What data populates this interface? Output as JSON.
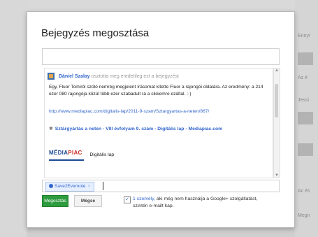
{
  "background": {
    "top_text": "",
    "right_labels": [
      "Ennyi",
      "Az é",
      "Jessi",
      "Ac és",
      "Megn"
    ]
  },
  "dialog": {
    "title": "Bejegyzés megosztása",
    "comment_placeholder": "",
    "post": {
      "author": "Dániel Szalay",
      "action": "osztotta meg eredetileg ezt a bejegyzést",
      "text": "Egy, Fluor Tomiról szóló nemrég megjelent írásomat kitette Fluor a rajongói oldalára. Az eredmény: a 214 ezer 080 rajongója közül több ezer szabadult rá a cikkemre ezáltal. :-)",
      "link": "http://www.mediapiac.com/digitalis-lap/2011-9-szam/Sztargyartas-a-neten/867/",
      "article_title": "Sztárgyártás a neten - VIII évfolyam 9. szám - Digitális lap - Mediapiac.com",
      "logo_text_main": "MÉDIA",
      "logo_text_accent": "PIAC",
      "logo_caption": "Digitális lap"
    },
    "recipient_chip": "Save2Evernote",
    "share_label": "Megosztás",
    "cancel_label": "Mégse",
    "email_link": "1 személy,",
    "email_text": "aki még nem használja a Google+ szolgáltatást, szintén e-mailt kap."
  },
  "colors": {
    "share_green": "#2e9b3f",
    "link_blue": "#3366cc"
  }
}
